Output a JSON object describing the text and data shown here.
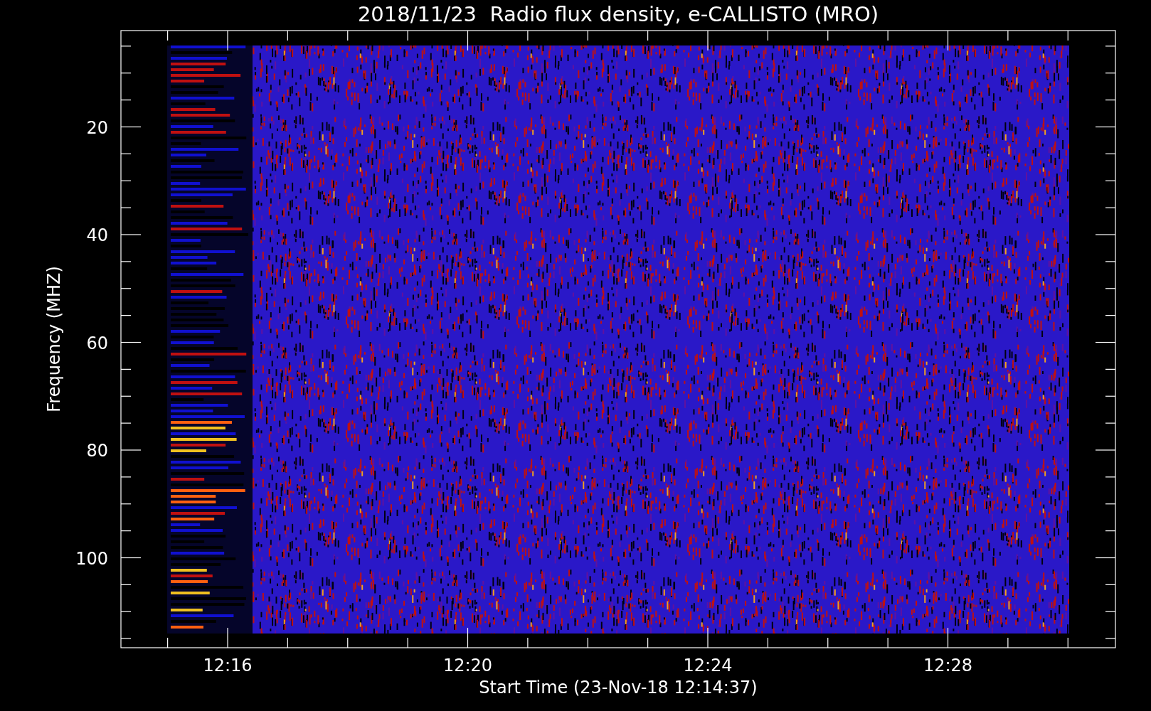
{
  "chart": {
    "title": "2018/11/23  Radio flux density, e-CALLISTO (MRO)",
    "ylabel": "Frequency (MHZ)",
    "yticks": [
      "20",
      "40",
      "60",
      "80",
      "100"
    ],
    "xticks": [
      "12:16",
      "12:20",
      "12:24",
      "12:28"
    ],
    "xlabel": "Start Time (23-Nov-18 12:14:37)"
  }
}
